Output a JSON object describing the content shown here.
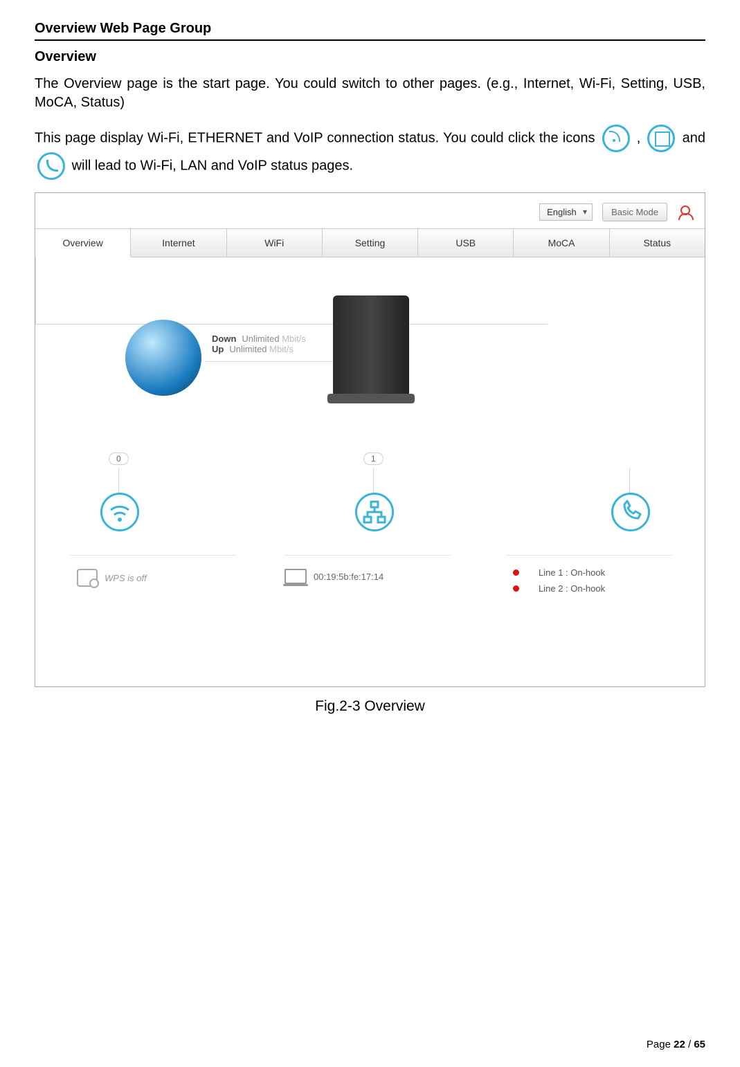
{
  "section_title": "Overview Web Page Group",
  "subsection_title": "Overview",
  "para1": "The Overview page is the start page. You could switch to other pages. (e.g., Internet, Wi-Fi, Setting, USB, MoCA, Status)",
  "para2_a": "This page display Wi-Fi, ETHERNET and VoIP connection status. You could click the icons ",
  "para2_b": " , ",
  "para2_c": " and ",
  "para2_d": " will lead to Wi-Fi, LAN and VoIP status pages.",
  "topbar": {
    "language": "English",
    "mode_button": "Basic Mode"
  },
  "tabs": [
    "Overview",
    "Internet",
    "WiFi",
    "Setting",
    "USB",
    "MoCA",
    "Status"
  ],
  "active_tab_index": 0,
  "speed": {
    "down_label": "Down",
    "down_value": "Unlimited",
    "down_unit": "Mbit/s",
    "up_label": "Up",
    "up_value": "Unlimited",
    "up_unit": "Mbit/s"
  },
  "counts": {
    "wifi": "0",
    "lan": "1"
  },
  "wps_status": "WPS is off",
  "mac": "00:19:5b:fe:17:14",
  "voip": {
    "line1": "Line 1 : On-hook",
    "line2": "Line 2 : On-hook"
  },
  "figure_caption": "Fig.2-3 Overview",
  "footer": {
    "prefix": "Page ",
    "current": "22",
    "sep": " / ",
    "total": "65"
  }
}
